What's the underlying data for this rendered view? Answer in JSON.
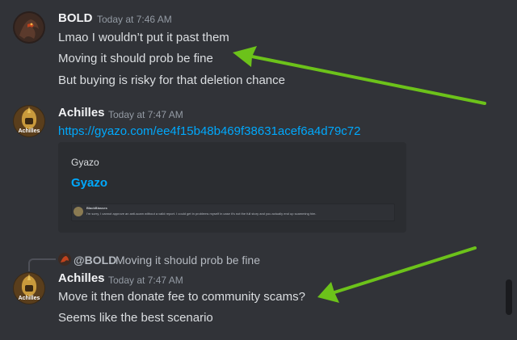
{
  "messages": [
    {
      "author": "BOLD",
      "timestamp": "Today at 7:46 AM",
      "lines": [
        "Lmao I wouldn’t put it past them",
        "Moving it should prob be fine",
        "But buying is risky for that deletion chance"
      ]
    },
    {
      "author": "Achilles",
      "timestamp": "Today at 7:47 AM",
      "link": "https://gyazo.com/ee4f15b48b469f38631acef6a4d79c72",
      "embed": {
        "provider": "Gyazo",
        "title": "Gyazo",
        "image_text_author": "BlackBlasses",
        "image_text_body": "I'm sorry, I cannot approve an anti-scam without a valid report. I could get in problems myself in case it's not the full story and you actually end up scamming him."
      }
    },
    {
      "reply_to_author": "@BOLD",
      "reply_to_text": "Moving it should prob be fine",
      "author": "Achilles",
      "timestamp": "Today at 7:47 AM",
      "lines": [
        "Move it then donate fee to community scams?",
        "Seems like the best scenario"
      ]
    }
  ],
  "avatar_label": "Achilles",
  "colors": {
    "background": "#313338",
    "link": "#00a8fc",
    "arrow": "#6cc21a",
    "username": "#f2f3f5",
    "timestamp": "#949ba4"
  }
}
